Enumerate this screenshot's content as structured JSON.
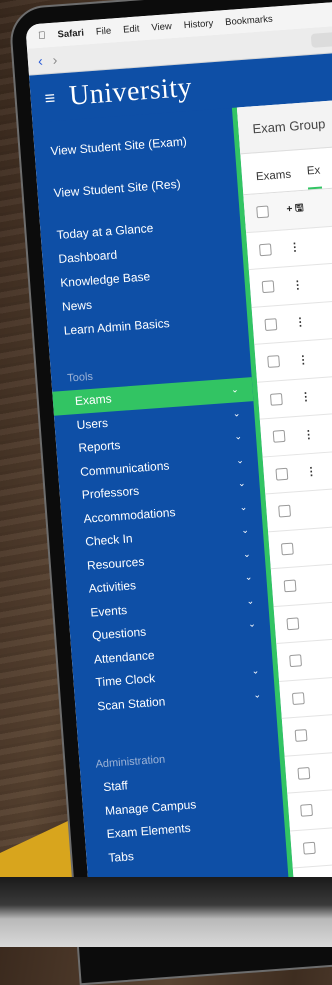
{
  "browser": {
    "menu": [
      "Safari",
      "File",
      "Edit",
      "View",
      "History",
      "Bookmarks"
    ]
  },
  "header": {
    "brand": "University"
  },
  "sidebar": {
    "links": [
      "View Student Site (Exam)",
      "View Student Site (Res)"
    ],
    "quick_links": [
      "Today at a Glance",
      "Dashboard",
      "Knowledge Base",
      "News",
      "Learn Admin Basics"
    ],
    "tools_label": "Tools",
    "tools": [
      "Exams",
      "Users",
      "Reports",
      "Communications",
      "Professors",
      "Accommodations",
      "Check In",
      "Resources",
      "Activities",
      "Events",
      "Questions",
      "Attendance",
      "Time Clock",
      "Scan Station"
    ],
    "admin_label": "Administration",
    "admin": [
      "Staff",
      "Manage Campus",
      "Exam Elements",
      "Tabs"
    ]
  },
  "main": {
    "title": "Exam Group",
    "tabs": [
      "Exams",
      "Ex"
    ],
    "header_icons": "+ 🖫"
  },
  "colors": {
    "primary": "#0e4fa6",
    "accent": "#32c463"
  }
}
